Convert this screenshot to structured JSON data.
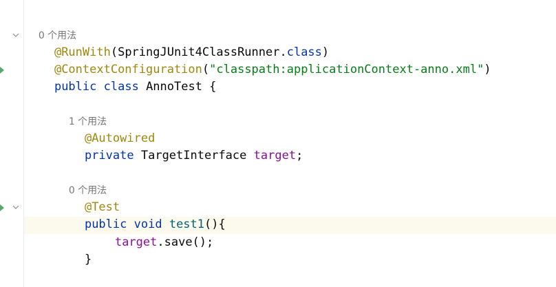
{
  "editor": {
    "lines": {
      "hint_class": "0 个用法",
      "runwith_ann": "@RunWith",
      "runwith_open": "(SpringJUnit4ClassRunner.",
      "runwith_class_kw": "class",
      "runwith_close": ")",
      "ctxconf_ann": "@ContextConfiguration",
      "ctxconf_open": "(",
      "ctxconf_str": "\"classpath:applicationContext-anno.xml\"",
      "ctxconf_close": ")",
      "class_kw_public": "public",
      "class_kw_class": "class",
      "class_name": "AnnoTest {",
      "hint_field": "1 个用法",
      "autowired_ann": "@Autowired",
      "field_kw_private": "private",
      "field_type": "TargetInterface",
      "field_name": "target",
      "field_semicolon": ";",
      "hint_method": "0 个用法",
      "test_ann": "@Test",
      "method_kw_public": "public",
      "method_kw_void": "void",
      "method_name": "test1",
      "method_sig_rest": "(){",
      "call_target": "target",
      "call_rest": ".save();",
      "method_close": "}"
    },
    "icons": {
      "fold_class": "chevron-down-icon",
      "fold_method": "chevron-down-icon",
      "run_class": "run-gutter-icon",
      "run_method": "run-gutter-icon"
    },
    "colors": {
      "annotation": "#9e880d",
      "keyword": "#0033b3",
      "string": "#067d17",
      "field": "#871094",
      "method": "#00627a",
      "hint": "#767676",
      "current_line_bg": "#fcfaed"
    }
  }
}
